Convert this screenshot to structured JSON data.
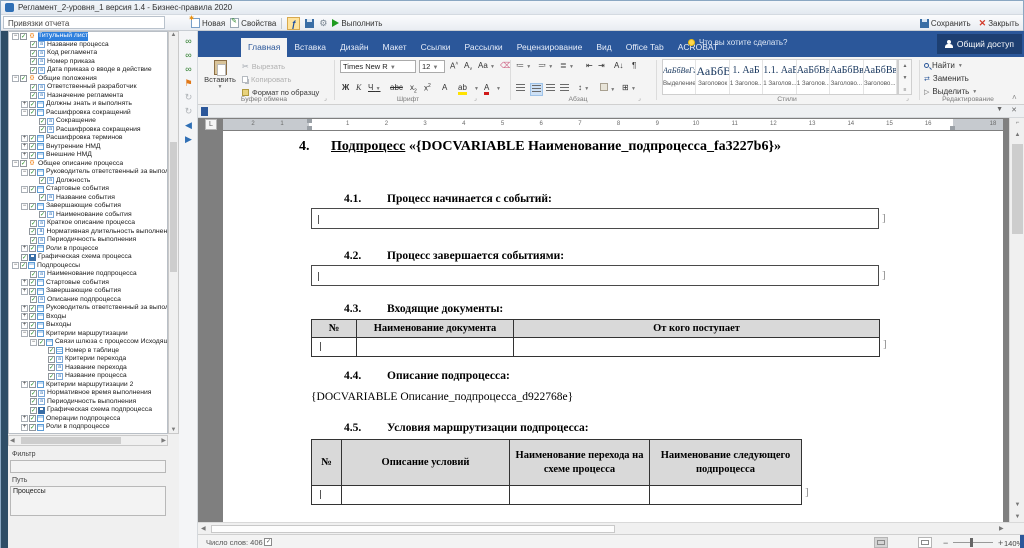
{
  "app": {
    "title": "Регламент_2-уровня_1 версия 1.4 - Бизнес-правила 2020",
    "panel_header": "Привязки отчета",
    "toolbar": {
      "new": "Новая",
      "properties": "Свойства",
      "run": "Выполнить"
    },
    "window_buttons": {
      "save": "Сохранить",
      "close": "Закрыть"
    },
    "filter_label": "Фильтр",
    "filter_value": "",
    "path_label": "Путь",
    "path_value": "Процессы"
  },
  "side_toolbar": {
    "icons": [
      {
        "name": "search-first-icon",
        "glyph": "∞",
        "color": "#2d7d2d"
      },
      {
        "name": "search-icon",
        "glyph": "∞",
        "color": "#2d7d2d"
      },
      {
        "name": "search-next-icon",
        "glyph": "∞",
        "color": "#2d7d2d"
      },
      {
        "name": "flag-icon",
        "glyph": "⚑",
        "color": "#e07818"
      },
      {
        "name": "refresh-icon",
        "glyph": "↻",
        "color": "#b0b4b8"
      },
      {
        "name": "refresh-all-icon",
        "glyph": "↻",
        "color": "#b0b4b8"
      },
      {
        "name": "prev-icon",
        "glyph": "◀",
        "color": "#2f6fb5"
      },
      {
        "name": "next-icon",
        "glyph": "▶",
        "color": "#2f6fb5"
      }
    ]
  },
  "tree": {
    "items": [
      {
        "label": "Титульный лист",
        "level": 0,
        "expand": "-",
        "icon": "sec",
        "selected": true
      },
      {
        "label": "Название процесса",
        "level": 1,
        "expand": "",
        "icon": "fld"
      },
      {
        "label": "Код регламента",
        "level": 1,
        "expand": "",
        "icon": "fld"
      },
      {
        "label": "Номер приказа",
        "level": 1,
        "expand": "",
        "icon": "fld"
      },
      {
        "label": "Дата приказа о вводе в действие",
        "level": 1,
        "expand": "",
        "icon": "fld"
      },
      {
        "label": "Общие положения",
        "level": 0,
        "expand": "-",
        "icon": "sec"
      },
      {
        "label": "Ответственный разработчик",
        "level": 1,
        "expand": "",
        "icon": "fld"
      },
      {
        "label": "Назначение регламента",
        "level": 1,
        "expand": "",
        "icon": "fld"
      },
      {
        "label": "Должны знать и выполнять",
        "level": 1,
        "expand": "+",
        "icon": "tbl"
      },
      {
        "label": "Расшифровка сокращений",
        "level": 1,
        "expand": "-",
        "icon": "tbl"
      },
      {
        "label": "Сокращение",
        "level": 2,
        "expand": "",
        "icon": "fld"
      },
      {
        "label": "Расшифровка сокращения",
        "level": 2,
        "expand": "",
        "icon": "fld"
      },
      {
        "label": "Расшифровка терминов",
        "level": 1,
        "expand": "+",
        "icon": "tbl"
      },
      {
        "label": "Внутренние НМД",
        "level": 1,
        "expand": "+",
        "icon": "tbl"
      },
      {
        "label": "Внешние НМД",
        "level": 1,
        "expand": "+",
        "icon": "tbl"
      },
      {
        "label": "Общее описание процесса",
        "level": 0,
        "expand": "-",
        "icon": "sec"
      },
      {
        "label": "Руководитель ответственный за выполнение",
        "level": 1,
        "expand": "-",
        "icon": "tbl"
      },
      {
        "label": "Должность",
        "level": 2,
        "expand": "",
        "icon": "fld"
      },
      {
        "label": "Стартовые события",
        "level": 1,
        "expand": "-",
        "icon": "tbl"
      },
      {
        "label": "Название события",
        "level": 2,
        "expand": "",
        "icon": "fld"
      },
      {
        "label": "Завершающие события",
        "level": 1,
        "expand": "-",
        "icon": "tbl"
      },
      {
        "label": "Наименование события",
        "level": 2,
        "expand": "",
        "icon": "fld"
      },
      {
        "label": "Краткое описание процесса",
        "level": 1,
        "expand": "",
        "icon": "fld"
      },
      {
        "label": "Нормативная длительность выполнения",
        "level": 1,
        "expand": "",
        "icon": "fld"
      },
      {
        "label": "Периодичность выполнения",
        "level": 1,
        "expand": "",
        "icon": "fld"
      },
      {
        "label": "Роли в процессе",
        "level": 1,
        "expand": "+",
        "icon": "tbl"
      },
      {
        "label": "Графическая схема процесса",
        "level": 0,
        "expand": "",
        "icon": "img"
      },
      {
        "label": "Подпроцессы",
        "level": 0,
        "expand": "-",
        "icon": "tbl"
      },
      {
        "label": "Наименование подпроцесса",
        "level": 1,
        "expand": "",
        "icon": "fld"
      },
      {
        "label": "Стартовые события",
        "level": 1,
        "expand": "+",
        "icon": "tbl"
      },
      {
        "label": "Завершающие события",
        "level": 1,
        "expand": "+",
        "icon": "tbl"
      },
      {
        "label": "Описание подпроцесса",
        "level": 1,
        "expand": "",
        "icon": "fld"
      },
      {
        "label": "Руководитель ответственный за выполнение",
        "level": 1,
        "expand": "+",
        "icon": "tbl"
      },
      {
        "label": "Входы",
        "level": 1,
        "expand": "+",
        "icon": "tbl"
      },
      {
        "label": "Выходы",
        "level": 1,
        "expand": "+",
        "icon": "tbl"
      },
      {
        "label": "Критерии маршрутизации",
        "level": 1,
        "expand": "-",
        "icon": "tbl"
      },
      {
        "label": "Связи шлюза с процессом Исходящий",
        "level": 2,
        "expand": "-",
        "icon": "tbl"
      },
      {
        "label": "Номер в таблице",
        "level": 3,
        "expand": "",
        "icon": "lst"
      },
      {
        "label": "Критерии перехода",
        "level": 3,
        "expand": "",
        "icon": "fld"
      },
      {
        "label": "Название перехода",
        "level": 3,
        "expand": "",
        "icon": "fld"
      },
      {
        "label": "Название процесса",
        "level": 3,
        "expand": "",
        "icon": "fld"
      },
      {
        "label": "Критерии маршрутизации 2",
        "level": 1,
        "expand": "+",
        "icon": "tbl"
      },
      {
        "label": "Нормативное время выполнения",
        "level": 1,
        "expand": "",
        "icon": "fld"
      },
      {
        "label": "Периодичность выполнения",
        "level": 1,
        "expand": "",
        "icon": "fld"
      },
      {
        "label": "Графическая схема подпроцесса",
        "level": 1,
        "expand": "",
        "icon": "img"
      },
      {
        "label": "Операции подпроцесса",
        "level": 1,
        "expand": "+",
        "icon": "tbl"
      },
      {
        "label": "Роли в подпроцессе",
        "level": 1,
        "expand": "+",
        "icon": "tbl"
      }
    ]
  },
  "ribbon": {
    "tabs": [
      "Главная",
      "Вставка",
      "Дизайн",
      "Макет",
      "Ссылки",
      "Рассылки",
      "Рецензирование",
      "Вид",
      "Office Tab",
      "ACROBAT"
    ],
    "active_tab": "Главная",
    "tell_me": "Что вы хотите сделать?",
    "share": "Общий доступ",
    "clipboard": {
      "paste": "Вставить",
      "cut": "Вырезать",
      "copy": "Копировать",
      "format_painter": "Формат по образцу",
      "group": "Буфер обмена"
    },
    "font": {
      "family": "Times New R",
      "size": "12",
      "group": "Шрифт"
    },
    "paragraph": {
      "group": "Абзац"
    },
    "styles": {
      "group": "Стили",
      "items": [
        {
          "preview": "АаБбВвГг",
          "label": "Выделение"
        },
        {
          "preview": "АаБбВ",
          "label": "Заголовок"
        },
        {
          "preview": "1. АаБ",
          "label": "1 Заголов..."
        },
        {
          "preview": "1.1. АаБ",
          "label": "1 Заголов..."
        },
        {
          "preview": "АаБбВв",
          "label": "1 Заголов..."
        },
        {
          "preview": "АаБбВв",
          "label": "Заголово..."
        },
        {
          "preview": "АаБбВвГ",
          "label": "Заголово..."
        }
      ]
    },
    "editing": {
      "group": "Редактирование",
      "find": "Найти",
      "replace": "Заменить",
      "select": "Выделить"
    }
  },
  "document": {
    "heading": {
      "num": "4.",
      "word": "Подпроцесс",
      "rest": " «{DOCVARIABLE Наименование_подпроцесса_fa3227b6}»"
    },
    "sections": [
      {
        "num": "4.1.",
        "title": "Процесс начинается с событий:",
        "type": "box"
      },
      {
        "num": "4.2.",
        "title": "Процесс завершается событиями:",
        "type": "box"
      },
      {
        "num": "4.3.",
        "title": "Входящие документы:",
        "type": "table",
        "headers": [
          "№",
          "Наименование документа",
          "От кого поступает"
        ]
      },
      {
        "num": "4.4.",
        "title": "Описание подпроцесса:",
        "type": "text",
        "text": "{DOCVARIABLE Описание_подпроцесса_d922768e}"
      },
      {
        "num": "4.5.",
        "title": "Условия маршрутизации подпроцесса:",
        "type": "table",
        "headers": [
          "№",
          "Описание условий",
          "Наименование перехода на схеме процесса",
          "Наименование следующего подпроцесса"
        ]
      }
    ],
    "ruler": {
      "left_numbers": [
        "2",
        "1"
      ],
      "main_numbers": [
        "1",
        "2",
        "3",
        "4",
        "5",
        "6",
        "7",
        "8",
        "9",
        "10",
        "11",
        "12",
        "13",
        "14",
        "15",
        "16"
      ],
      "right_numbers": [
        "18"
      ]
    }
  },
  "statusbar": {
    "words": "Число слов: 406",
    "zoom_level": "140%"
  }
}
